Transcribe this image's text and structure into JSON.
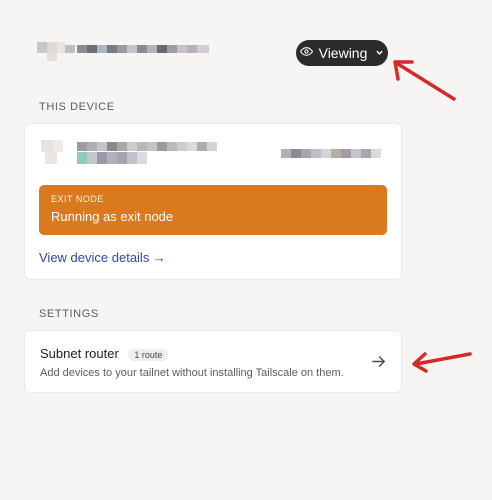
{
  "header": {
    "viewing_label": "Viewing",
    "eye_icon": "eye-icon",
    "chevron_icon": "chevron-down-icon"
  },
  "this_device": {
    "section_title": "THIS DEVICE",
    "exit_node": {
      "label": "EXIT NODE",
      "status": "Running as exit node"
    },
    "details_link": "View device details →"
  },
  "settings": {
    "section_title": "SETTINGS",
    "subnet_router": {
      "title": "Subnet router",
      "badge": "1 route",
      "description": "Add devices to your tailnet without installing Tailscale on them.",
      "arrow_icon": "arrow-right-icon"
    }
  },
  "colors": {
    "background": "#f6f5f3",
    "exit_node": "#d97a1e",
    "link": "#2a4cab",
    "pill": "#2b2b2b",
    "annotation_arrow": "#d42a2a"
  }
}
